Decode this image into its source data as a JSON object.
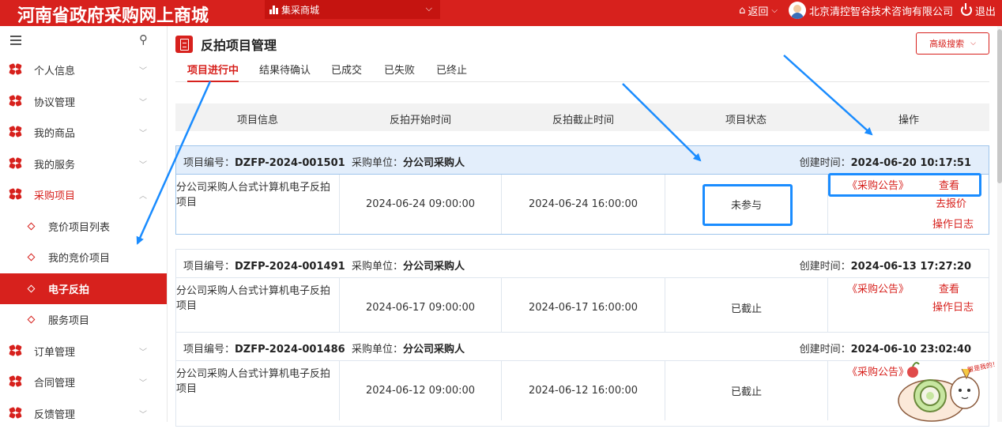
{
  "header": {
    "site_title": "河南省政府采购网上商城",
    "mall_select": "集采商城",
    "back": "返回",
    "company": "北京清控智谷技术咨询有限公司",
    "logout": "退出",
    "brand_color": "#d7211d"
  },
  "sidebar": {
    "items": [
      {
        "label": "个人信息"
      },
      {
        "label": "协议管理"
      },
      {
        "label": "我的商品"
      },
      {
        "label": "我的服务"
      },
      {
        "label": "采购项目"
      }
    ],
    "subitems": [
      {
        "label": "竞价项目列表"
      },
      {
        "label": "我的竞价项目"
      },
      {
        "label": "电子反拍"
      },
      {
        "label": "服务项目"
      }
    ],
    "items_after": [
      {
        "label": "订单管理"
      },
      {
        "label": "合同管理"
      },
      {
        "label": "反馈管理"
      }
    ],
    "active": "电子反拍"
  },
  "main": {
    "title": "反拍项目管理",
    "adv_search": "高级搜索",
    "tabs": [
      "项目进行中",
      "结果待确认",
      "已成交",
      "已失败",
      "已终止"
    ],
    "active_tab": "项目进行中",
    "columns": [
      "项目信息",
      "反拍开始时间",
      "反拍截止时间",
      "项目状态",
      "操作"
    ],
    "code_label": "项目编号：",
    "unit_label": "采购单位：",
    "ctime_label": "创建时间：",
    "rows": [
      {
        "code": "DZFP-2024-001501",
        "unit": "分公司采购人",
        "created": "2024-06-20 10:17:51",
        "name": "分公司采购人台式计算机电子反拍项目",
        "start": "2024-06-24 09:00:00",
        "end": "2024-06-24 16:00:00",
        "status": "未参与",
        "ops": [
          "《采购公告》",
          "查看",
          "去报价",
          "操作日志"
        ]
      },
      {
        "code": "DZFP-2024-001491",
        "unit": "分公司采购人",
        "created": "2024-06-13 17:27:20",
        "name": "分公司采购人台式计算机电子反拍项目",
        "start": "2024-06-17 09:00:00",
        "end": "2024-06-17 16:00:00",
        "status": "已截止",
        "ops": [
          "《采购公告》",
          "查看",
          "操作日志"
        ]
      },
      {
        "code": "DZFP-2024-001486",
        "unit": "分公司采购人",
        "created": "2024-06-10 23:02:40",
        "name": "分公司采购人台式计算机电子反拍项目",
        "start": "2024-06-12 09:00:00",
        "end": "2024-06-12 16:00:00",
        "status": "已截止",
        "ops": [
          "《采购公告》"
        ]
      }
    ]
  },
  "mascot_text": "智是我的！"
}
